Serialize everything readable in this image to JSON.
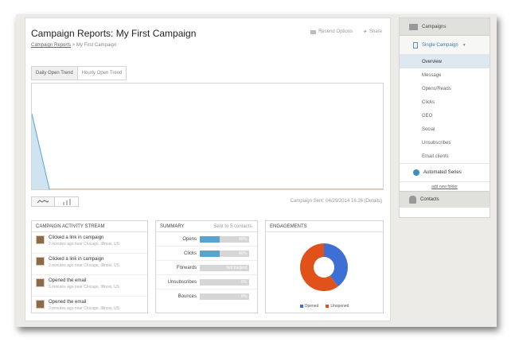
{
  "header": {
    "title": "Campaign Reports: My First Campaign",
    "resend_label": "Resend Options",
    "share_label": "Share"
  },
  "breadcrumb": {
    "link": "Campaign Reports",
    "separator": ">",
    "current": "My First Campaign"
  },
  "tabs": [
    {
      "label": "Daily Open Trend",
      "active": true
    },
    {
      "label": "Hourly Open Trend",
      "active": false
    }
  ],
  "chart_data": {
    "type": "area",
    "x": [
      0,
      1,
      2,
      3,
      4,
      5,
      6,
      7,
      8,
      9,
      10,
      11,
      12,
      13,
      14,
      15,
      16,
      17,
      18,
      19,
      20
    ],
    "values": [
      1,
      0,
      0,
      0,
      0,
      0,
      0,
      0,
      0,
      0,
      0,
      0,
      0,
      0,
      0,
      0,
      0,
      0,
      0,
      0,
      0
    ],
    "ylim": [
      0,
      1.4
    ],
    "color": "#5aa3d0",
    "fill": "#cfe3f1"
  },
  "campaign_sent": "Campaign Sent: 04/29/2014 16:26 (Details)",
  "activity": {
    "title": "CAMPAIGN ACTIVITY STREAM",
    "items": [
      {
        "text": "Clicked a link in campaign",
        "meta": "2 minutes ago near Chicago, Illinois, US"
      },
      {
        "text": "Clicked a link in campaign",
        "meta": "2 minutes ago near Chicago, Illinois, US"
      },
      {
        "text": "Opened the email",
        "meta": "3 minutes ago near Chicago, Illinois, US"
      },
      {
        "text": "Opened the email",
        "meta": "3 minutes ago near Chicago, Illinois, US"
      }
    ]
  },
  "summary": {
    "title": "SUMMARY",
    "subtitle": "Sent to 5 contacts.",
    "rows": [
      {
        "label": "Opens",
        "value": "40%",
        "fill": 0.4
      },
      {
        "label": "Clicks",
        "value": "40%",
        "fill": 0.4
      },
      {
        "label": "Forwards",
        "value": "Not tracked",
        "fill": 0
      },
      {
        "label": "Unsubscribes",
        "value": "0%",
        "fill": 0
      },
      {
        "label": "Bounces",
        "value": "0%",
        "fill": 0
      }
    ]
  },
  "engagements": {
    "title": "ENGAGEMENTS",
    "slices": [
      {
        "label": "Opened",
        "value": 40,
        "color": "#3d6fd4"
      },
      {
        "label": "Unopened",
        "value": 60,
        "color": "#e0521a"
      }
    ]
  },
  "sidebar": {
    "campaigns": "Campaigns",
    "single_campaign": "Single Campaign",
    "items": [
      {
        "label": "Overview",
        "active": true
      },
      {
        "label": "Message",
        "active": false
      },
      {
        "label": "Opens/Reads",
        "active": false
      },
      {
        "label": "Clicks",
        "active": false
      },
      {
        "label": "GEO",
        "active": false
      },
      {
        "label": "Social",
        "active": false
      },
      {
        "label": "Unsubscribes",
        "active": false
      },
      {
        "label": "Email clients",
        "active": false
      }
    ],
    "automated_series": "Automated Series",
    "add_folder": "add new folder",
    "contacts": "Contacts"
  }
}
